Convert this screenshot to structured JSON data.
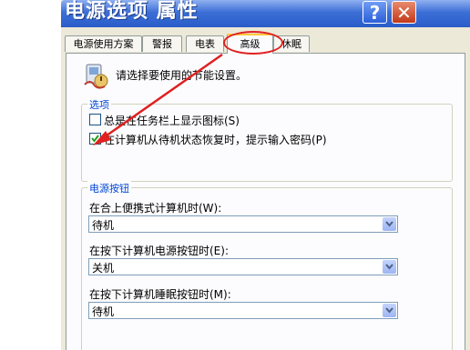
{
  "window": {
    "title": "电源选项 属性",
    "help_label": "?",
    "close_label": "✕"
  },
  "tabs": [
    {
      "label": "电源使用方案"
    },
    {
      "label": "警报"
    },
    {
      "label": "电表"
    },
    {
      "label": "高级",
      "active": true
    },
    {
      "label": "休眠"
    }
  ],
  "intro": {
    "icon": "power-settings-icon",
    "text": "请选择要使用的节能设置。"
  },
  "options": {
    "legend": "选项",
    "show_tray_icon": {
      "label": "总是在任务栏上显示图标(S)",
      "checked": false
    },
    "prompt_password": {
      "label": "在计算机从待机状态恢复时，提示输入密码(P)",
      "checked": true
    }
  },
  "power_buttons": {
    "legend": "电源按钮",
    "lid_close": {
      "label": "在合上便携式计算机时(W):",
      "value": "待机"
    },
    "power_button": {
      "label": "在按下计算机电源按钮时(E):",
      "value": "关机"
    },
    "sleep_button": {
      "label": "在按下计算机睡眠按钮时(M):",
      "value": "待机"
    }
  },
  "annotation_color": "#e02020"
}
